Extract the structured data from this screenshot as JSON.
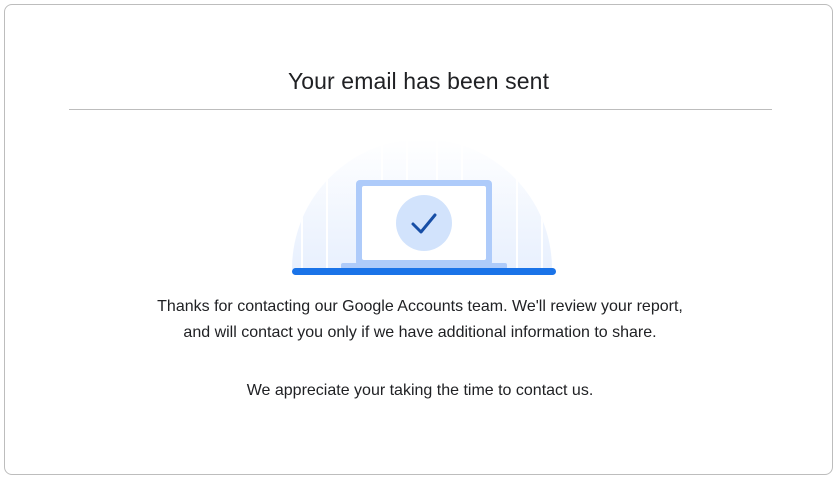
{
  "dialog": {
    "title": "Your email has been sent",
    "message": "Thanks for contacting our Google Accounts team. We'll review your report, and will contact you only if we have additional information to share.",
    "appreciation": "We appreciate your taking the time to contact us."
  },
  "illustration": {
    "icon": "laptop-checkmark-icon",
    "accent_color": "#1a73e8",
    "check_color": "#174ea6",
    "screen_color": "#d2e3fc"
  }
}
